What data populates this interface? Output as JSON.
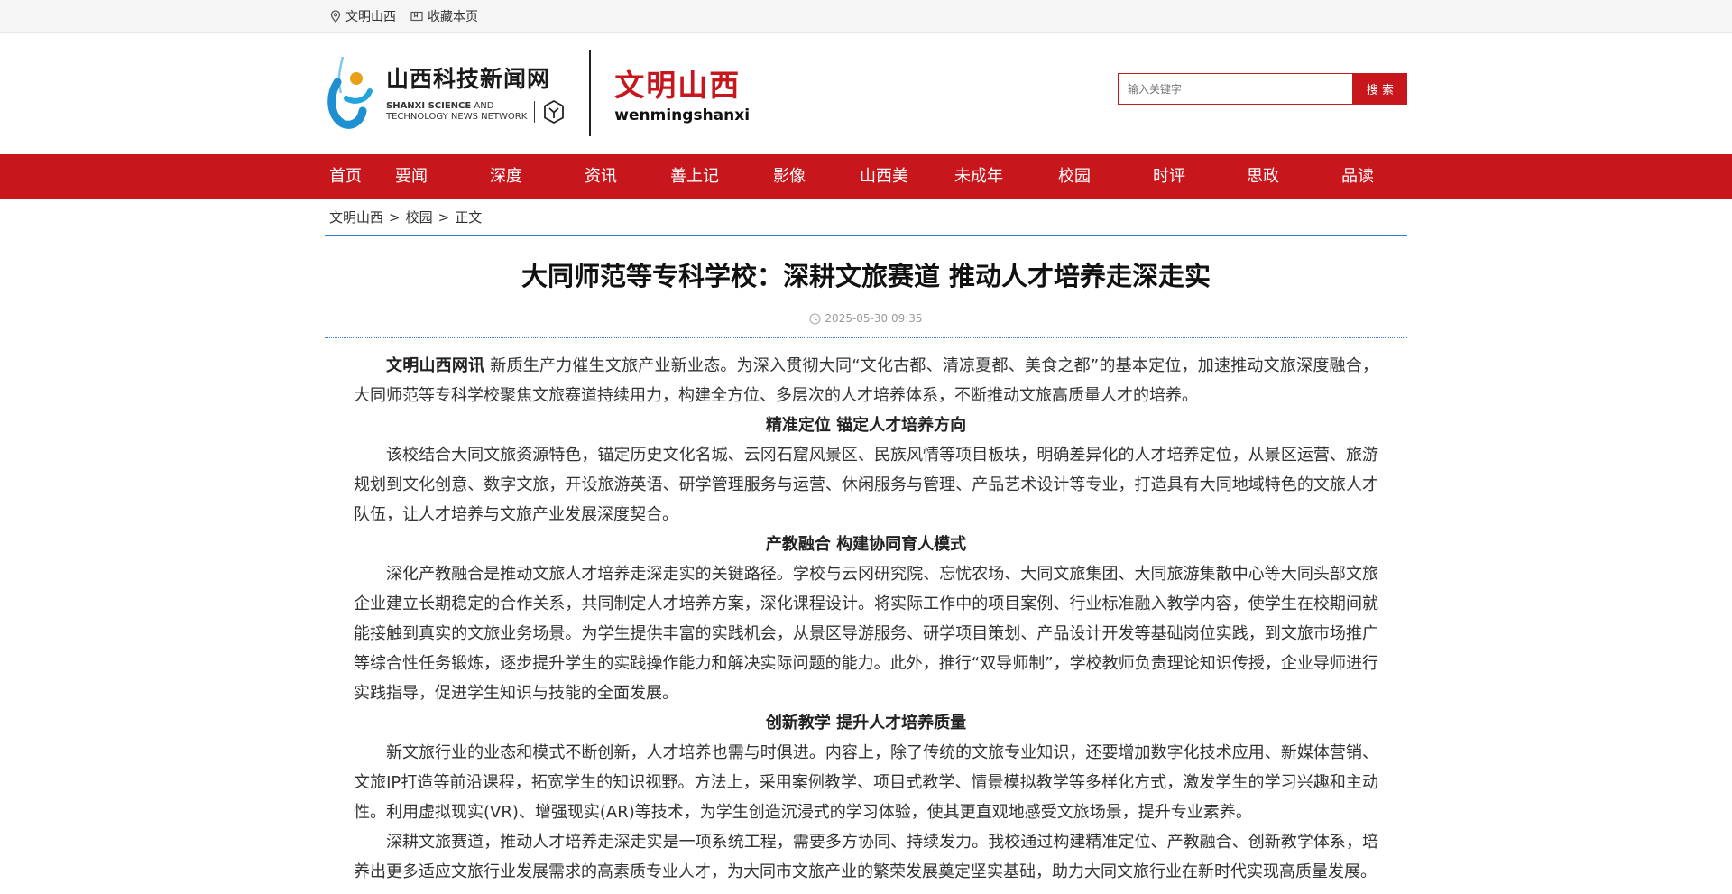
{
  "topbar": {
    "location": "文明山西",
    "bookmark": "收藏本页"
  },
  "header": {
    "logo_cn": "山西科技新闻网",
    "logo_en_bold": "SHANXI SCIENCE",
    "logo_en_rest": " AND",
    "logo_en_line2": "TECHNOLOGY NEWS NETWORK",
    "brand_cn": "文明山西",
    "brand_en": "wenmingshanxi"
  },
  "search": {
    "placeholder": "输入关键字",
    "button": "搜 索"
  },
  "nav": {
    "items": [
      "首页",
      "要闻",
      "深度",
      "资讯",
      "善上记",
      "影像",
      "山西美",
      "未成年",
      "校园",
      "时评",
      "思政",
      "品读"
    ]
  },
  "breadcrumb": {
    "items": [
      "文明山西",
      "校园",
      "正文"
    ],
    "sep": ">"
  },
  "article": {
    "title": "大同师范等专科学校：深耕文旅赛道 推动人才培养走深走实",
    "date": "2025-05-30 09:35",
    "lead_source": "文明山西网讯",
    "lead_text": " 新质生产力催生文旅产业新业态。为深入贯彻大同“文化古都、清凉夏都、美食之都”的基本定位，加速推动文旅深度融合，大同师范等专科学校聚焦文旅赛道持续用力，构建全方位、多层次的人才培养体系，不断推动文旅高质量人才的培养。",
    "sub1": "精准定位 锚定人才培养方向",
    "p1": "该校结合大同文旅资源特色，锚定历史文化名城、云冈石窟风景区、民族风情等项目板块，明确差异化的人才培养定位，从景区运营、旅游规划到文化创意、数字文旅，开设旅游英语、研学管理服务与运营、休闲服务与管理、产品艺术设计等专业，打造具有大同地域特色的文旅人才队伍，让人才培养与文旅产业发展深度契合。",
    "sub2": "产教融合 构建协同育人模式",
    "p2": "深化产教融合是推动文旅人才培养走深走实的关键路径。学校与云冈研究院、忘忧农场、大同文旅集团、大同旅游集散中心等大同头部文旅企业建立长期稳定的合作关系，共同制定人才培养方案，深化课程设计。将实际工作中的项目案例、行业标准融入教学内容，使学生在校期间就能接触到真实的文旅业务场景。为学生提供丰富的实践机会，从景区导游服务、研学项目策划、产品设计开发等基础岗位实践，到文旅市场推广等综合性任务锻炼，逐步提升学生的实践操作能力和解决实际问题的能力。此外，推行“双导师制”，学校教师负责理论知识传授，企业导师进行实践指导，促进学生知识与技能的全面发展。",
    "sub3": "创新教学 提升人才培养质量",
    "p3": "新文旅行业的业态和模式不断创新，人才培养也需与时俱进。内容上，除了传统的文旅专业知识，还要增加数字化技术应用、新媒体营销、文旅IP打造等前沿课程，拓宽学生的知识视野。方法上，采用案例教学、项目式教学、情景模拟教学等多样化方式，激发学生的学习兴趣和主动性。利用虚拟现实(VR)、增强现实(AR)等技术，为学生创造沉浸式的学习体验，使其更直观地感受文旅场景，提升专业素养。",
    "p4": "深耕文旅赛道，推动人才培养走深走实是一项系统工程，需要多方协同、持续发力。我校通过构建精准定位、产教融合、创新教学体系，培养出更多适应文旅行业发展需求的高素质专业人才，为大同市文旅产业的繁荣发展奠定坚实基础，助力大同文旅行业在新时代实现高质量发展。"
  },
  "colors": {
    "brand_red": "#c8161d",
    "accent_blue": "#3a7bd5"
  }
}
